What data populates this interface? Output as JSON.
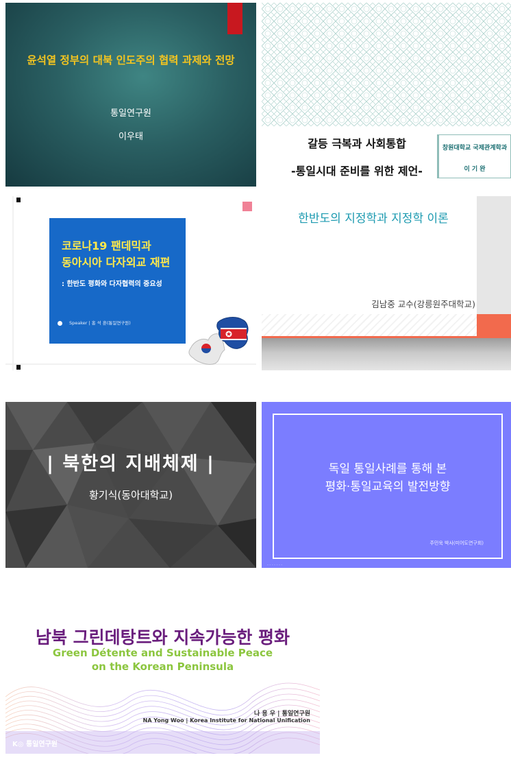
{
  "slides": [
    {
      "title": "윤석열 정부의 대북 인도주의 협력 과제와 전망",
      "organization": "통일연구원",
      "author": "이우태",
      "colors": {
        "background": "#2a5f62",
        "title": "#f3c420",
        "tab": "#c8181f"
      }
    },
    {
      "title": "갈등 극복과 사회통합",
      "subtitle": "-통일시대 준비를 위한 제언-",
      "school": "창원대학교 국제관계학과",
      "author": "이 기 완",
      "colors": {
        "pattern": "#9fc9c3",
        "accent": "#1b6f72"
      }
    },
    {
      "title_line1": "코로나19 팬데믹과",
      "title_line2": "동아시아 다자외교 재편",
      "subtitle": ": 한반도 평화와 다자협력의 중요성",
      "speaker": "Speaker | 홍 석 훈(통일연구원)",
      "colors": {
        "panel": "#1769c8",
        "title": "#ffe94a"
      },
      "icon": "korea-puzzle-icon"
    },
    {
      "title": "한반도의 지정학과 지정학 이론",
      "author": "김남중 교수(강릉원주대학교)",
      "colors": {
        "title": "#1c9ab0",
        "accent": "#f26a4d"
      }
    },
    {
      "title": "| 북한의 지배체제 |",
      "author": "황기식(동아대학교)",
      "colors": {
        "background": "#4a4a4a"
      }
    },
    {
      "title_line1": "독일 통일사례를 통해 본",
      "title_line2": "평화·통일교육의 발전방향",
      "author": "주민욱 박사(미어도연구회)",
      "footer": "- - - - - - -",
      "colors": {
        "background": "#7b7dff"
      }
    },
    {
      "title_kr": "남북 그린데탕트와 지속가능한 평화",
      "title_en_line1": "Green Détente and Sustainable Peace",
      "title_en_line2": "on the Korean Peninsula",
      "author_kr": "나 용 우  |  통일연구원",
      "author_en": "NA Yong Woo | Korea Institute for National Unification",
      "logo": "통일연구원",
      "colors": {
        "title": "#6a1e7d",
        "subtitle": "#8cc63f"
      }
    }
  ]
}
